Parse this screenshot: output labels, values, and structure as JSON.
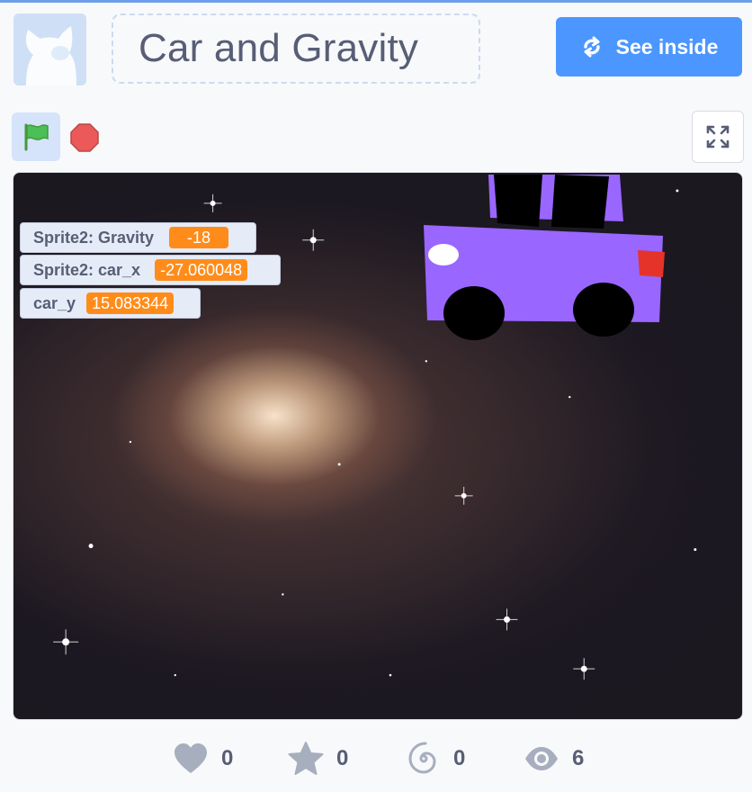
{
  "project": {
    "title": "Car and Gravity",
    "see_inside_label": "See inside"
  },
  "controls": {
    "green_flag_icon": "green-flag-icon",
    "stop_icon": "stop-sign-icon",
    "fullscreen_icon": "fullscreen-icon"
  },
  "monitors": [
    {
      "label": "Sprite2: Gravity",
      "value": "-18"
    },
    {
      "label": "Sprite2: car_x",
      "value": "-27.060048"
    },
    {
      "label": "car_y",
      "value": "15.083344"
    }
  ],
  "stats": {
    "loves": "0",
    "favorites": "0",
    "remixes": "0",
    "views": "6"
  },
  "colors": {
    "accent": "#4c97ff",
    "monitor_value": "#ff8c1a",
    "car_body": "#9966ff",
    "text": "#575e75"
  }
}
